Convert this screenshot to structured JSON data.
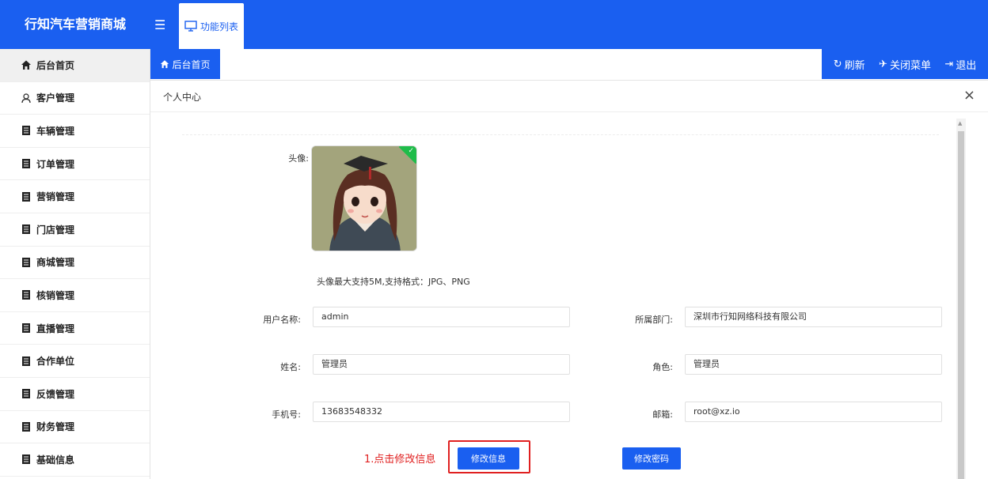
{
  "header": {
    "brand": "行知汽车营销商城",
    "func_tab_label": "功能列表"
  },
  "sidebar": {
    "items": [
      {
        "label": "后台首页",
        "icon": "home-icon"
      },
      {
        "label": "客户管理",
        "icon": "user-icon"
      },
      {
        "label": "车辆管理",
        "icon": "doc-icon"
      },
      {
        "label": "订单管理",
        "icon": "doc-icon"
      },
      {
        "label": "营销管理",
        "icon": "doc-icon"
      },
      {
        "label": "门店管理",
        "icon": "doc-icon"
      },
      {
        "label": "商城管理",
        "icon": "doc-icon"
      },
      {
        "label": "核销管理",
        "icon": "doc-icon"
      },
      {
        "label": "直播管理",
        "icon": "doc-icon"
      },
      {
        "label": "合作单位",
        "icon": "doc-icon"
      },
      {
        "label": "反馈管理",
        "icon": "doc-icon"
      },
      {
        "label": "财务管理",
        "icon": "doc-icon"
      },
      {
        "label": "基础信息",
        "icon": "doc-icon"
      }
    ]
  },
  "tabs": {
    "home": "后台首页",
    "refresh": "刷新",
    "close_menu": "关闭菜单",
    "logout": "退出"
  },
  "panel": {
    "title": "个人中心",
    "close": "×"
  },
  "profile": {
    "avatar_label": "头像:",
    "avatar_hint": "头像最大支持5M,支持格式：JPG、PNG",
    "username_label": "用户名称:",
    "username_value": "admin",
    "dept_label": "所属部门:",
    "dept_value": "深圳市行知网络科技有限公司",
    "name_label": "姓名:",
    "name_value": "管理员",
    "role_label": "角色:",
    "role_value": "管理员",
    "phone_label": "手机号:",
    "phone_value": "13683548332",
    "email_label": "邮箱:",
    "email_value": "root@xz.io",
    "edit_info_btn": "修改信息",
    "edit_pwd_btn": "修改密码",
    "annotation": "1.点击修改信息"
  },
  "colors": {
    "primary": "#1a5ff0",
    "annotation": "#e02020",
    "success": "#1fbc4a"
  }
}
